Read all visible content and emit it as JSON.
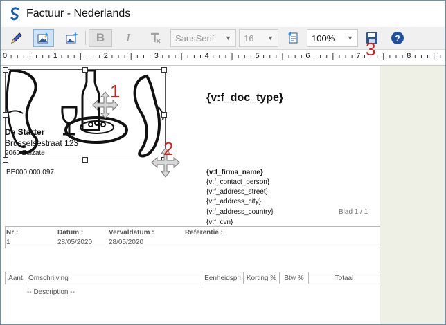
{
  "window": {
    "title": "Factuur - Nederlands"
  },
  "toolbar": {
    "font_family": "SansSerif",
    "font_size": "16",
    "zoom": "100%",
    "bold_label": "B",
    "italic_label": "I"
  },
  "ruler": {
    "labels": [
      "0",
      "1",
      "2",
      "3",
      "4",
      "5",
      "6",
      "7",
      "8"
    ]
  },
  "callouts": [
    "1",
    "2",
    "3"
  ],
  "document": {
    "doc_type": "{v:f_doc_type}",
    "company_name": "De Starter",
    "company_street": "Brusselsestraat 123",
    "company_city": "9060 Zelzate",
    "vat": "BE000.000.097",
    "customer": {
      "firm_name": "{v:f_firma_name}",
      "contact_person": "{v:f_contact_person}",
      "address_street": "{v:f_address_street}",
      "address_city": "{v:f_address_city}",
      "address_country": "{v:f_address_country}",
      "cvn": "{v:f_cvn}"
    },
    "page_label": "Blad 1 / 1",
    "info": {
      "nr_label": "Nr :",
      "nr_value": "1",
      "date_label": "Datum :",
      "date_value": "28/05/2020",
      "due_label": "Vervaldatum :",
      "due_value": "28/05/2020",
      "ref_label": "Referentie :"
    },
    "columns": [
      "Aant",
      "Omschrijving",
      "Eenheidspri",
      "Korting %",
      "Btw %",
      "Totaal"
    ],
    "description_placeholder": "-- Description --"
  },
  "colors": {
    "callout": "#d21f1f",
    "selection": "#7eb4ea",
    "canvas_bg": "#eef0e5"
  }
}
